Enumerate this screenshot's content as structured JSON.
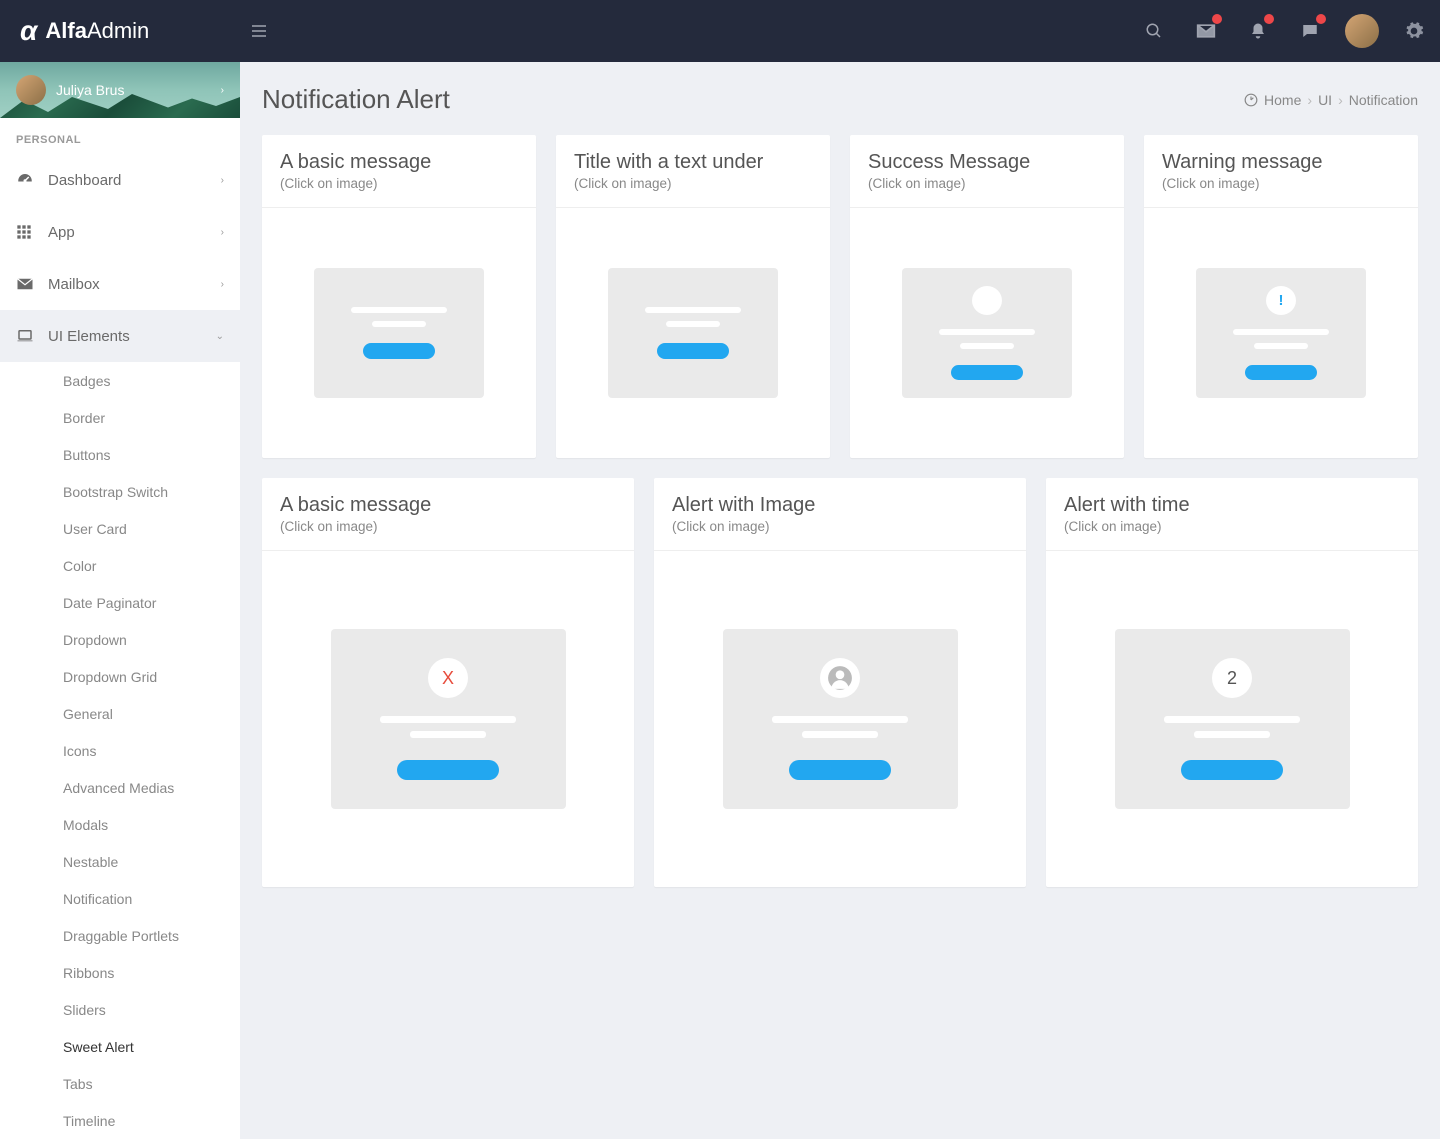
{
  "brand": {
    "bold": "Alfa",
    "light": "Admin"
  },
  "user": {
    "name": "Juliya Brus"
  },
  "nav_header": "PERSONAL",
  "nav": [
    {
      "label": "Dashboard",
      "icon": "dashboard"
    },
    {
      "label": "App",
      "icon": "grid"
    },
    {
      "label": "Mailbox",
      "icon": "mail"
    },
    {
      "label": "UI Elements",
      "icon": "laptop",
      "open": true
    }
  ],
  "ui_sub": [
    "Badges",
    "Border",
    "Buttons",
    "Bootstrap Switch",
    "User Card",
    "Color",
    "Date Paginator",
    "Dropdown",
    "Dropdown Grid",
    "General",
    "Icons",
    "Advanced Medias",
    "Modals",
    "Nestable",
    "Notification",
    "Draggable Portlets",
    "Ribbons",
    "Sliders",
    "Sweet Alert",
    "Tabs",
    "Timeline"
  ],
  "ui_current": "Sweet Alert",
  "page": {
    "title": "Notification Alert"
  },
  "breadcrumb": {
    "home": "Home",
    "mid": "UI",
    "last": "Notification"
  },
  "click_hint": "(Click on image)",
  "cards_row1": [
    {
      "title": "A basic message",
      "variant": "plain"
    },
    {
      "title": "Title with a text under",
      "variant": "plain"
    },
    {
      "title": "Success Message",
      "variant": "circle"
    },
    {
      "title": "Warning message",
      "variant": "exclaim"
    }
  ],
  "cards_row2": [
    {
      "title": "A basic message",
      "variant": "x"
    },
    {
      "title": "Alert with Image",
      "variant": "avatar"
    },
    {
      "title": "Alert with time",
      "variant": "timer",
      "timer_text": "2"
    }
  ]
}
